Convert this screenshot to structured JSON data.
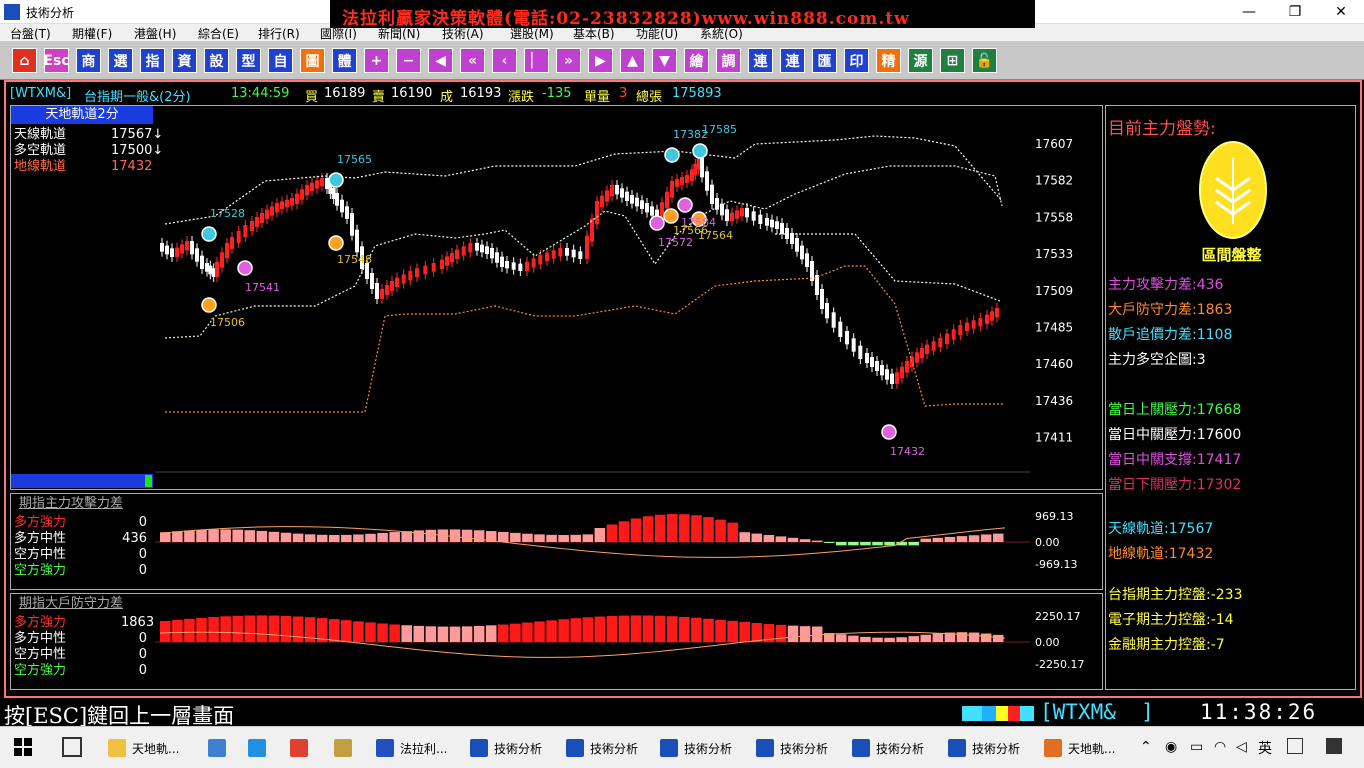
{
  "window": {
    "title": "技術分析",
    "banner": "法拉利贏家決策軟體(電話:02-23832828)www.win888.com.tw",
    "minimize": "—",
    "restore": "❐",
    "close": "✕"
  },
  "menu": [
    "台盤(T)",
    "期權(F)",
    "港盤(H)",
    "綜合(E)",
    "排行(R)",
    "國際(I)",
    "新聞(N)",
    "技術(A)",
    "選股(M)",
    "基本(B)",
    "功能(U)",
    "系統(O)"
  ],
  "toolbar": [
    {
      "label": "⌂",
      "name": "home-button",
      "color": "#e03020",
      "fg": "#fff"
    },
    {
      "label": "Esc",
      "name": "esc-button",
      "color": "#d040c0",
      "fg": "#fff"
    },
    {
      "label": "商",
      "name": "commodity-button",
      "color": "#2040d0",
      "fg": "#fff"
    },
    {
      "label": "選",
      "name": "select-button",
      "color": "#2040d0",
      "fg": "#fff"
    },
    {
      "label": "指",
      "name": "index-button",
      "color": "#2040d0",
      "fg": "#fff"
    },
    {
      "label": "資",
      "name": "data-button",
      "color": "#2040d0",
      "fg": "#fff"
    },
    {
      "label": "設",
      "name": "setup-button",
      "color": "#2040d0",
      "fg": "#fff"
    },
    {
      "label": "型",
      "name": "pattern-button",
      "color": "#2040d0",
      "fg": "#fff"
    },
    {
      "label": "自",
      "name": "custom-button",
      "color": "#2040d0",
      "fg": "#fff"
    },
    {
      "label": "圖",
      "name": "chart-button",
      "color": "#f07010",
      "fg": "#fff"
    },
    {
      "label": "體",
      "name": "layout-button",
      "color": "#2040d0",
      "fg": "#fff"
    },
    {
      "label": "+",
      "name": "zoom-in-button",
      "color": "#c040d0",
      "fg": "#fff"
    },
    {
      "label": "−",
      "name": "zoom-out-button",
      "color": "#c040d0",
      "fg": "#fff"
    },
    {
      "label": "◀",
      "name": "prev-button",
      "color": "#c040d0",
      "fg": "#fff"
    },
    {
      "label": "«",
      "name": "fast-back-button",
      "color": "#c040d0",
      "fg": "#fff"
    },
    {
      "label": "‹",
      "name": "step-back-button",
      "color": "#c040d0",
      "fg": "#fff"
    },
    {
      "label": "▏",
      "name": "cursor-button",
      "color": "#c040d0",
      "fg": "#fff"
    },
    {
      "label": "»",
      "name": "fast-forward-button",
      "color": "#c040d0",
      "fg": "#fff"
    },
    {
      "label": "▶",
      "name": "next-button",
      "color": "#c040d0",
      "fg": "#fff"
    },
    {
      "label": "▲",
      "name": "up-button",
      "color": "#c040d0",
      "fg": "#fff"
    },
    {
      "label": "▼",
      "name": "down-button",
      "color": "#c040d0",
      "fg": "#fff"
    },
    {
      "label": "繪",
      "name": "draw-button",
      "color": "#c040d0",
      "fg": "#fff"
    },
    {
      "label": "調",
      "name": "adjust-button",
      "color": "#c040d0",
      "fg": "#fff"
    },
    {
      "label": "連",
      "name": "link-button",
      "color": "#2040d0",
      "fg": "#fff"
    },
    {
      "label": "連",
      "name": "link2-button",
      "color": "#2040d0",
      "fg": "#fff"
    },
    {
      "label": "匯",
      "name": "export-button",
      "color": "#2040d0",
      "fg": "#fff"
    },
    {
      "label": "印",
      "name": "print-button",
      "color": "#2040d0",
      "fg": "#fff"
    },
    {
      "label": "精",
      "name": "refine-button",
      "color": "#f07010",
      "fg": "#fff"
    },
    {
      "label": "源",
      "name": "source-button",
      "color": "#208040",
      "fg": "#fff"
    },
    {
      "label": "⊞",
      "name": "window-button",
      "color": "#208040",
      "fg": "#fff"
    },
    {
      "label": "🔓",
      "name": "lock-button",
      "color": "#208040",
      "fg": "#fff"
    }
  ],
  "infobar": {
    "code": "[WTXM&]",
    "name": "台指期一般&(2分)",
    "time": "13:44:59",
    "bid_label": "買",
    "bid": "16189",
    "ask_label": "賣",
    "ask": "16190",
    "deal_label": "成",
    "deal": "16193",
    "chg_label": "漲跌",
    "chg": "-135",
    "vol_label": "單量",
    "vol": "3",
    "total_label": "總張",
    "total": "175893"
  },
  "main_legend": {
    "title": "天地軌道2分",
    "rows": [
      {
        "label": "天線軌道",
        "value": "17567↓",
        "color": "#ffffff"
      },
      {
        "label": "多空軌道",
        "value": "17500↓",
        "color": "#ffffff"
      },
      {
        "label": "地線軌道",
        "value": "17432",
        "color": "#ff6a4a"
      }
    ]
  },
  "price_axis": [
    "17607",
    "17582",
    "17558",
    "17533",
    "17509",
    "17485",
    "17460",
    "17436",
    "17411"
  ],
  "annotations": [
    {
      "text": "17528",
      "color": "#3ec8e0"
    },
    {
      "text": "17541",
      "color": "#e060e0"
    },
    {
      "text": "17506",
      "color": "#e0c020"
    },
    {
      "text": "17565",
      "color": "#3ec8e0"
    },
    {
      "text": "17548",
      "color": "#e0c020"
    },
    {
      "text": "17382",
      "color": "#3ec8e0"
    },
    {
      "text": "17585",
      "color": "#3ec8e0"
    },
    {
      "text": "17572",
      "color": "#e060e0"
    },
    {
      "text": "17566",
      "color": "#e0c020"
    },
    {
      "text": "17564",
      "color": "#e0c020"
    },
    {
      "text": "17584",
      "color": "#e060e0"
    },
    {
      "text": "17432",
      "color": "#e060e0"
    }
  ],
  "sub1": {
    "title": "期指主力攻擊力差",
    "rows": [
      {
        "label": "多方強力",
        "value": "0",
        "color": "#ff3030"
      },
      {
        "label": "多方中性",
        "value": "436",
        "color": "#ffffff"
      },
      {
        "label": "空方中性",
        "value": "0",
        "color": "#ffffff"
      },
      {
        "label": "空方強力",
        "value": "0",
        "color": "#40ff40"
      }
    ],
    "axis": [
      "969.13",
      "0.00",
      "-969.13"
    ]
  },
  "sub2": {
    "title": "期指大戶防守力差",
    "rows": [
      {
        "label": "多方強力",
        "value": "1863",
        "color": "#ff3030"
      },
      {
        "label": "多方中性",
        "value": "0",
        "color": "#ffffff"
      },
      {
        "label": "空方中性",
        "value": "0",
        "color": "#ffffff"
      },
      {
        "label": "空方強力",
        "value": "0",
        "color": "#40ff40"
      }
    ],
    "axis": [
      "2250.17",
      "0.00",
      "-2250.17"
    ]
  },
  "side": {
    "title": "目前主力盤勢:",
    "state": "區間盤整",
    "lines": [
      {
        "text": "主力攻擊力差:436",
        "color": "#e050e0"
      },
      {
        "text": "大戶防守力差:1863",
        "color": "#ff8a2a"
      },
      {
        "text": "散戶追價力差:1108",
        "color": "#40e0ff"
      },
      {
        "text": "主力多空企圖:3",
        "color": "#ffffff"
      },
      {
        "text": "當日上關壓力:17668",
        "color": "#40ff40"
      },
      {
        "text": "當日中關壓力:17600",
        "color": "#ffffff"
      },
      {
        "text": "當日中關支撐:17417",
        "color": "#e050e0"
      },
      {
        "text": "當日下關壓力:17302",
        "color": "#e03060"
      },
      {
        "text": "天線軌道:17567",
        "color": "#40e0ff"
      },
      {
        "text": "地線軌道:17432",
        "color": "#ff8a2a"
      },
      {
        "text": "台指期主力控盤:-233",
        "color": "#ffff40"
      },
      {
        "text": "電子期主力控盤:-14",
        "color": "#ffff40"
      },
      {
        "text": "金融期主力控盤:-7",
        "color": "#ffff40"
      }
    ]
  },
  "status": {
    "hint": "按[ESC]鍵回上一層畫面",
    "code": "[WTXM&  ]",
    "clock": "11:38:26"
  },
  "taskbar": [
    {
      "label": "天地軌...",
      "color": "#f0c040"
    },
    {
      "label": "",
      "color": "#4080d0"
    },
    {
      "label": "",
      "color": "#2090e0"
    },
    {
      "label": "",
      "color": "#e04030"
    },
    {
      "label": "",
      "color": "#c0a040"
    },
    {
      "label": "法拉利...",
      "color": "#2050c0"
    },
    {
      "label": "技術分析",
      "color": "#1b4fb8"
    },
    {
      "label": "技術分析",
      "color": "#1b4fb8"
    },
    {
      "label": "技術分析",
      "color": "#1b4fb8"
    },
    {
      "label": "技術分析",
      "color": "#1b4fb8"
    },
    {
      "label": "技術分析",
      "color": "#1b4fb8"
    },
    {
      "label": "技術分析",
      "color": "#1b4fb8"
    },
    {
      "label": "天地軌...",
      "color": "#e07020"
    }
  ],
  "tray": {
    "lang": "英"
  }
}
